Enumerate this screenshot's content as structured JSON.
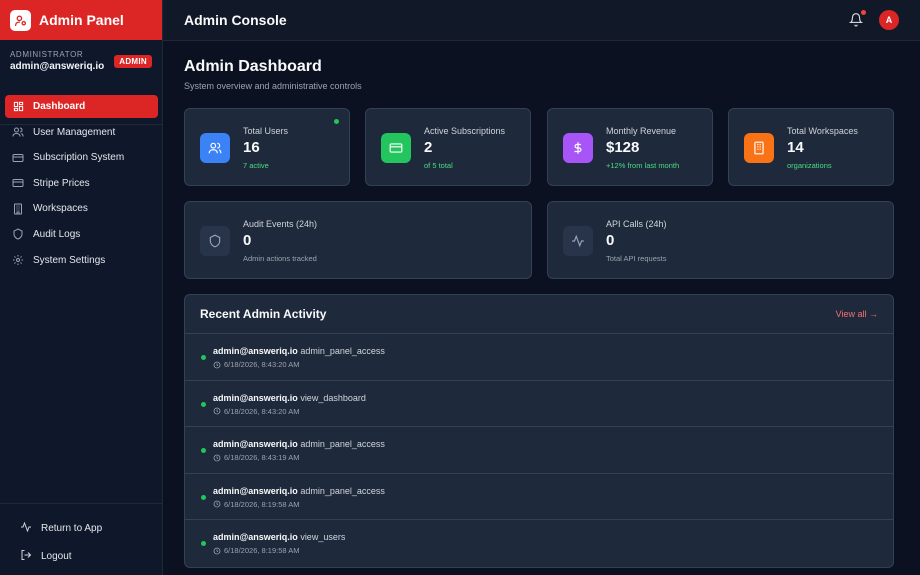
{
  "brand": {
    "title": "Admin Panel",
    "accent": "#dc2626"
  },
  "admin": {
    "role": "ADMINISTRATOR",
    "email": "admin@answeriq.io",
    "badge": "ADMIN"
  },
  "sidebar": {
    "items": [
      {
        "label": "Dashboard",
        "icon": "dashboard-icon",
        "active": true
      },
      {
        "label": "User Management",
        "icon": "users-icon"
      },
      {
        "label": "Subscription System",
        "icon": "credit-card-icon"
      },
      {
        "label": "Stripe Prices",
        "icon": "credit-card-icon"
      },
      {
        "label": "Workspaces",
        "icon": "building-icon"
      },
      {
        "label": "Audit Logs",
        "icon": "shield-icon"
      },
      {
        "label": "System Settings",
        "icon": "gear-icon"
      }
    ],
    "footer": [
      {
        "label": "Return to App",
        "icon": "activity-icon"
      },
      {
        "label": "Logout",
        "icon": "logout-icon"
      }
    ]
  },
  "topbar": {
    "title": "Admin Console",
    "avatar": "A"
  },
  "page": {
    "title": "Admin Dashboard",
    "subtitle": "System overview and administrative controls"
  },
  "stats": [
    {
      "label": "Total Users",
      "value": "16",
      "sub": "7 active",
      "color": "#3b82f6",
      "icon": "users-icon"
    },
    {
      "label": "Active Subscriptions",
      "value": "2",
      "sub": "of 5 total",
      "color": "#22c55e",
      "icon": "credit-card-icon"
    },
    {
      "label": "Monthly Revenue",
      "value": "$128",
      "sub": "+12% from last month",
      "color": "#a855f7",
      "icon": "dollar-icon"
    },
    {
      "label": "Total Workspaces",
      "value": "14",
      "sub": "organizations",
      "color": "#f97316",
      "icon": "building-icon"
    }
  ],
  "metrics": [
    {
      "label": "Audit Events (24h)",
      "value": "0",
      "sub": "Admin actions tracked",
      "icon": "shield-icon"
    },
    {
      "label": "API Calls (24h)",
      "value": "0",
      "sub": "Total API requests",
      "icon": "activity-icon"
    }
  ],
  "activity": {
    "title": "Recent Admin Activity",
    "view_all": "View all →",
    "rows": [
      {
        "user": "admin@answeriq.io",
        "action": "admin_panel_access",
        "time": "6/18/2026, 8:43:20 AM"
      },
      {
        "user": "admin@answeriq.io",
        "action": "view_dashboard",
        "time": "6/18/2026, 8:43:20 AM"
      },
      {
        "user": "admin@answeriq.io",
        "action": "admin_panel_access",
        "time": "6/18/2026, 8:43:19 AM"
      },
      {
        "user": "admin@answeriq.io",
        "action": "admin_panel_access",
        "time": "6/18/2026, 8:19:58 AM"
      },
      {
        "user": "admin@answeriq.io",
        "action": "view_users",
        "time": "6/18/2026, 8:19:58 AM"
      }
    ]
  }
}
